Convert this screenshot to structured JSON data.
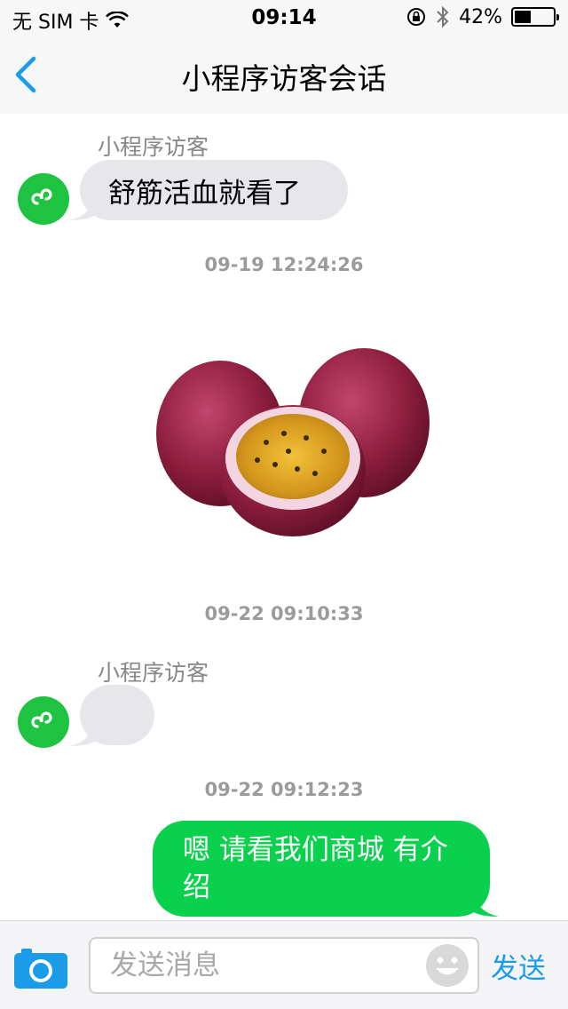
{
  "status_bar": {
    "carrier": "无 SIM 卡",
    "time": "09:14",
    "battery_percent_text": "42%",
    "battery_level": 0.42,
    "icons": [
      "wifi-icon",
      "orientation-lock-icon",
      "bluetooth-icon",
      "battery-icon"
    ]
  },
  "nav": {
    "title": "小程序访客会话",
    "back_icon": "chevron-left-icon"
  },
  "messages": {
    "msg1": {
      "sender": "小程序访客",
      "text": "舒筋活血就看了"
    },
    "ts1": "09-19 12:24:26",
    "image": {
      "description_icon": "passion-fruit-image"
    },
    "ts2": "09-22 09:10:33",
    "msg2": {
      "sender": "小程序访客",
      "text": ""
    },
    "ts3": "09-22 09:12:23",
    "msg3": {
      "text": "嗯 请看我们商城 有介绍"
    }
  },
  "input_bar": {
    "placeholder": "发送消息",
    "value": "",
    "send_label": "发送",
    "camera_icon": "camera-icon",
    "emoji_icon": "emoji-icon"
  },
  "colors": {
    "accent": "#1a9ce8",
    "avatar_green": "#1ec341",
    "outgoing_bubble": "#0ad14d",
    "incoming_bubble": "#e6e6eb",
    "timestamp": "#9b9b9b"
  }
}
